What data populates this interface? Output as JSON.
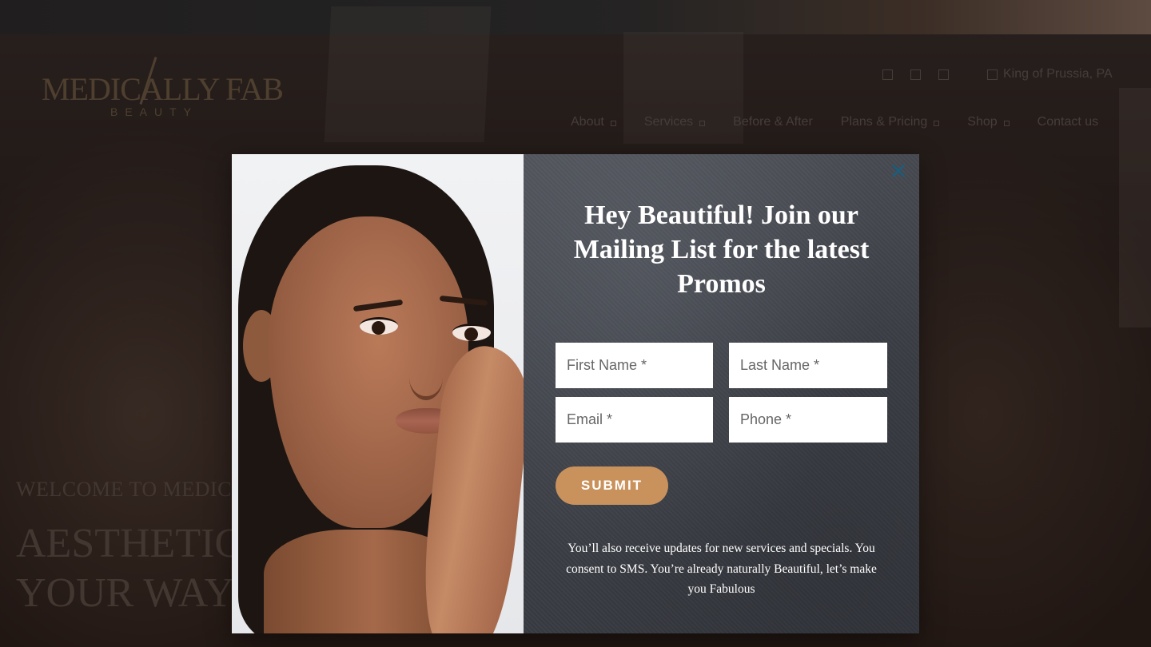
{
  "brand": {
    "logo_text": "MEDICALLY FAB",
    "logo_subtext": "BEAUTY",
    "logo_color": "#7f6a4f"
  },
  "utility": {
    "icons": [
      "social-icon-1",
      "social-icon-2",
      "social-icon-3"
    ],
    "location_icon": "map-pin-icon",
    "location": "King of Prussia, PA"
  },
  "nav": {
    "items": [
      {
        "label": "About",
        "has_dropdown": true
      },
      {
        "label": "Services",
        "has_dropdown": true
      },
      {
        "label": "Before & After",
        "has_dropdown": false
      },
      {
        "label": "Plans & Pricing",
        "has_dropdown": true
      },
      {
        "label": "Shop",
        "has_dropdown": true
      },
      {
        "label": "Contact us",
        "has_dropdown": false
      }
    ]
  },
  "hero": {
    "welcome": "WELCOME TO MEDICA",
    "title_line1": "AESTHETIC",
    "title_line2": "YOUR WAY"
  },
  "modal": {
    "close_icon": "close-icon",
    "headline": "Hey Beautiful! Join our Mailing List for the latest Promos",
    "fields": {
      "first_name_placeholder": "First Name *",
      "last_name_placeholder": "Last Name *",
      "email_placeholder": "Email *",
      "phone_placeholder": "Phone *"
    },
    "submit_label": "SUBMIT",
    "submit_color": "#c9925c",
    "disclaimer": "You’ll also receive updates for new services and specials. You consent to SMS. You’re already naturally Beautiful, let’s make you Fabulous"
  }
}
